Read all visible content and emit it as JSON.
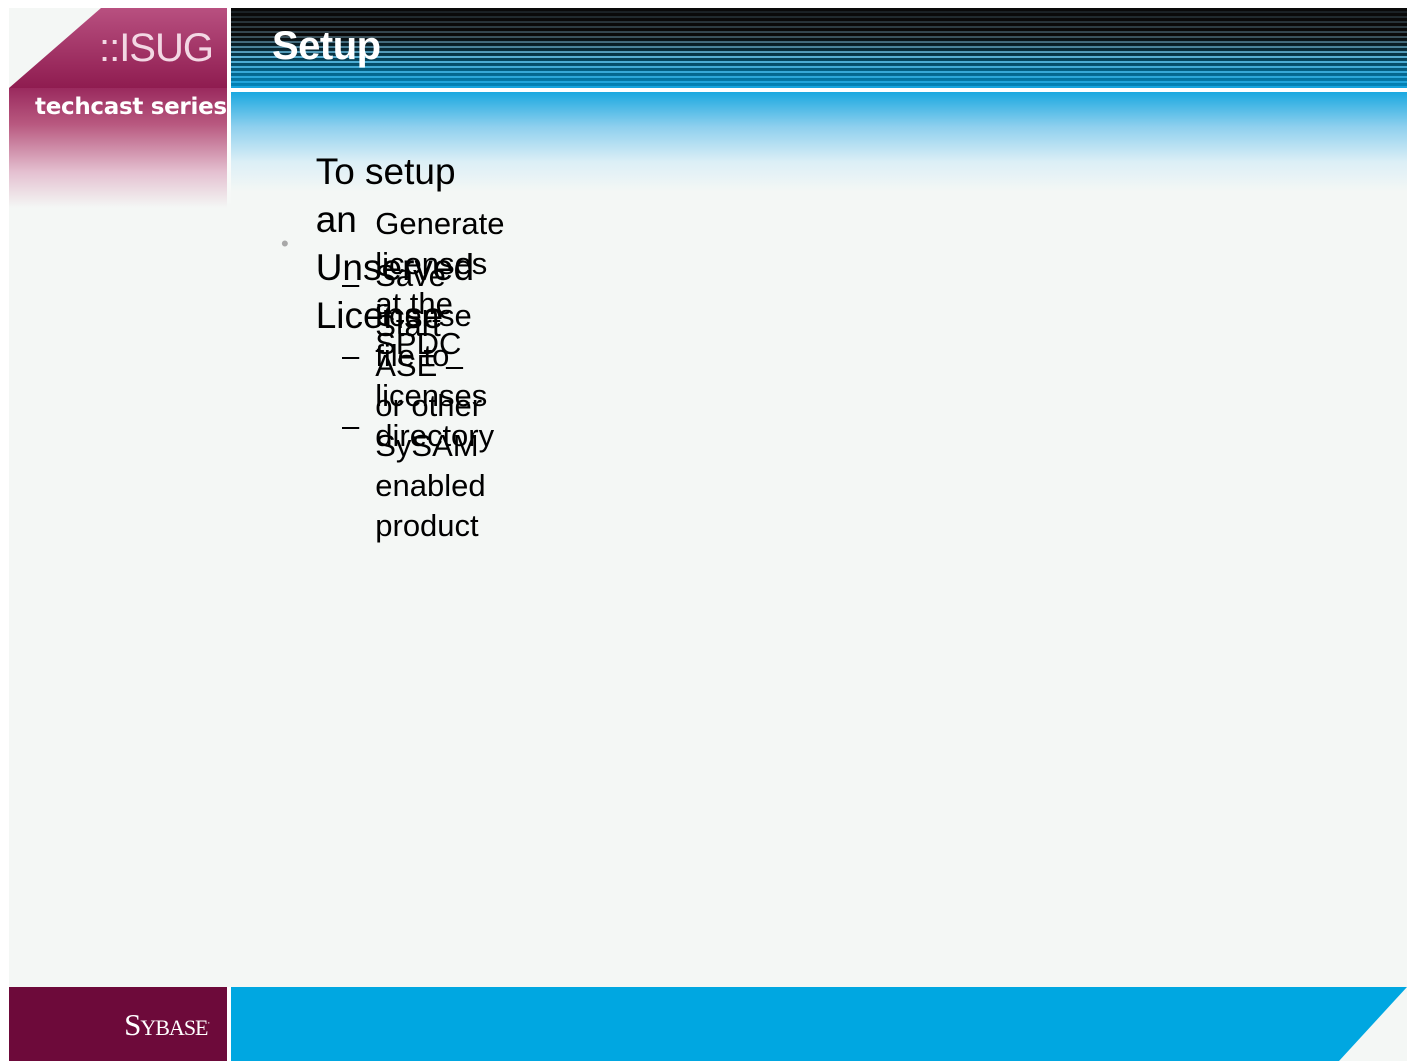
{
  "branding": {
    "isug": "::ISUG",
    "series": "techcast series",
    "company": "Sybase"
  },
  "title": "Setup",
  "bullets": [
    {
      "text": "To setup an Unserved License",
      "subitems": [
        "Generate licenses at the SPDC",
        "Save license file to licenses directory",
        "Start ASE – or other SySAM enabled product"
      ]
    }
  ],
  "colors": {
    "brand_maroon": "#6d0a3a",
    "brand_blue": "#00a7e1",
    "background": "#f4f7f5"
  }
}
